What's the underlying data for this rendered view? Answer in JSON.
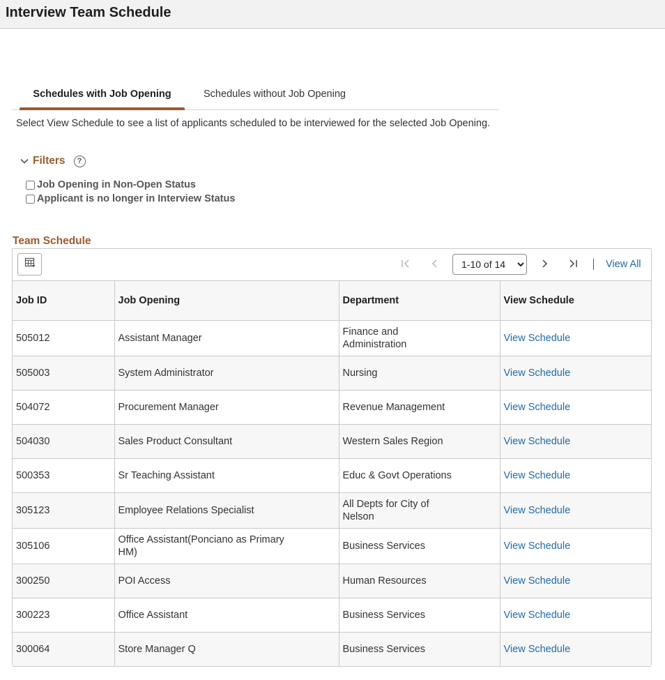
{
  "header": {
    "title": "Interview Team Schedule"
  },
  "tabs": [
    {
      "label": "Schedules with Job Opening",
      "active": true
    },
    {
      "label": "Schedules without Job Opening",
      "active": false
    }
  ],
  "instructions": "Select View Schedule to see a list of applicants scheduled to be interviewed for the selected Job Opening.",
  "filters": {
    "label": "Filters",
    "help_icon": "?",
    "options": [
      {
        "label": "Job Opening in Non-Open Status",
        "checked": false
      },
      {
        "label": "Applicant is no longer in Interview Status",
        "checked": false
      }
    ]
  },
  "grid": {
    "title": "Team Schedule",
    "pagination": {
      "selected": "1-10 of 14"
    },
    "view_all_label": "View All",
    "columns": [
      "Job ID",
      "Job Opening",
      "Department",
      "View Schedule"
    ],
    "rows": [
      {
        "job_id": "505012",
        "job_opening": "Assistant Manager",
        "department": "Finance and Administration",
        "action": "View Schedule"
      },
      {
        "job_id": "505003",
        "job_opening": "System Administrator",
        "department": "Nursing",
        "action": "View Schedule"
      },
      {
        "job_id": "504072",
        "job_opening": "Procurement Manager",
        "department": "Revenue Management",
        "action": "View Schedule"
      },
      {
        "job_id": "504030",
        "job_opening": "Sales Product Consultant",
        "department": "Western Sales Region",
        "action": "View Schedule"
      },
      {
        "job_id": "500353",
        "job_opening": "Sr Teaching Assistant",
        "department": "Educ & Govt Operations",
        "action": "View Schedule"
      },
      {
        "job_id": "305123",
        "job_opening": "Employee Relations Specialist",
        "department": "All Depts for City of Nelson",
        "action": "View Schedule"
      },
      {
        "job_id": "305106",
        "job_opening": "Office Assistant(Ponciano as Primary HM)",
        "department": "Business Services",
        "action": "View Schedule"
      },
      {
        "job_id": "300250",
        "job_opening": "POI Access",
        "department": "Human Resources",
        "action": "View Schedule"
      },
      {
        "job_id": "300223",
        "job_opening": "Office Assistant",
        "department": "Business Services",
        "action": "View Schedule"
      },
      {
        "job_id": "300064",
        "job_opening": "Store Manager Q",
        "department": "Business Services",
        "action": "View Schedule"
      }
    ]
  },
  "colors": {
    "accent": "#9b5b31",
    "link": "#1f6aa8",
    "border": "#c9c9c9",
    "header_bg": "#f2f2f2"
  }
}
